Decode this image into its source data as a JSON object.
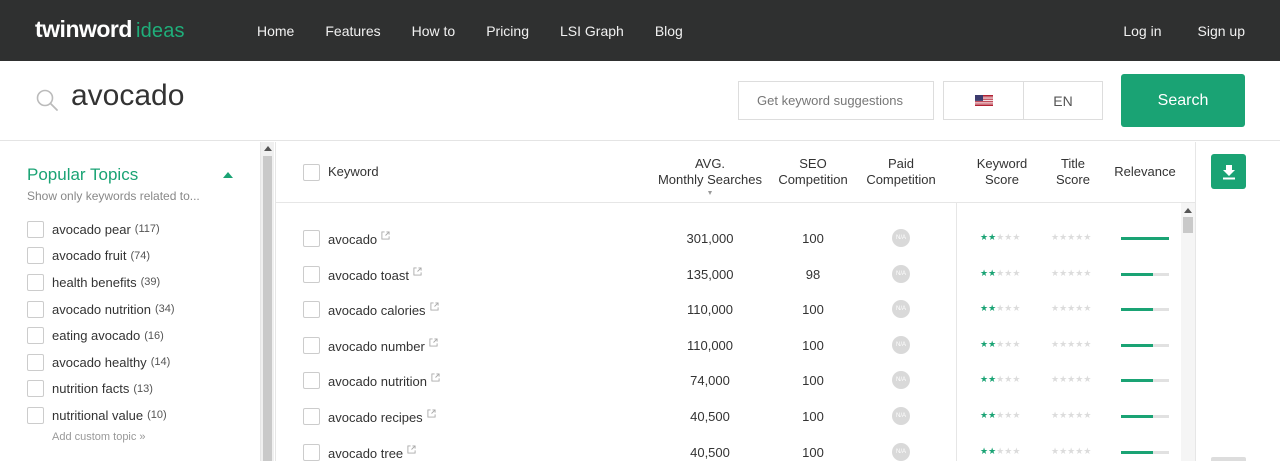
{
  "brand": {
    "name": "twinword",
    "sub": "ideas",
    "accent": "#1aa374"
  },
  "nav": {
    "items": [
      "Home",
      "Features",
      "How to",
      "Pricing",
      "LSI Graph",
      "Blog"
    ],
    "login": "Log in",
    "signup": "Sign up"
  },
  "search": {
    "query": "avocado",
    "suggest_placeholder": "Get keyword suggestions",
    "country_icon": "us-flag-icon",
    "language": "EN",
    "button": "Search"
  },
  "sidebar": {
    "title": "Popular Topics",
    "subtitle": "Show only keywords related to...",
    "topics": [
      {
        "label": "avocado pear",
        "count": "(117)"
      },
      {
        "label": "avocado fruit",
        "count": "(74)"
      },
      {
        "label": "health benefits",
        "count": "(39)"
      },
      {
        "label": "avocado nutrition",
        "count": "(34)"
      },
      {
        "label": "eating avocado",
        "count": "(16)"
      },
      {
        "label": "avocado healthy",
        "count": "(14)"
      },
      {
        "label": "nutrition facts",
        "count": "(13)"
      },
      {
        "label": "nutritional value",
        "count": "(10)"
      }
    ],
    "add_custom": "Add custom topic »"
  },
  "table": {
    "headers": {
      "keyword": "Keyword",
      "avg_1": "AVG.",
      "avg_2": "Monthly Searches",
      "seo_1": "SEO",
      "seo_2": "Competition",
      "paid_1": "Paid",
      "paid_2": "Competition",
      "ks_1": "Keyword",
      "ks_2": "Score",
      "ts_1": "Title",
      "ts_2": "Score",
      "relevance": "Relevance"
    },
    "rows": [
      {
        "keyword": "avocado",
        "volume": "301,000",
        "seo": "100",
        "paid": "N/A",
        "keyword_score": 2,
        "title_score": 0,
        "relevance": 1.0
      },
      {
        "keyword": "avocado toast",
        "volume": "135,000",
        "seo": "98",
        "paid": "N/A",
        "keyword_score": 2,
        "title_score": 0,
        "relevance": 0.66
      },
      {
        "keyword": "avocado calories",
        "volume": "110,000",
        "seo": "100",
        "paid": "N/A",
        "keyword_score": 2,
        "title_score": 0,
        "relevance": 0.66
      },
      {
        "keyword": "avocado number",
        "volume": "110,000",
        "seo": "100",
        "paid": "N/A",
        "keyword_score": 2,
        "title_score": 0,
        "relevance": 0.66
      },
      {
        "keyword": "avocado nutrition",
        "volume": "74,000",
        "seo": "100",
        "paid": "N/A",
        "keyword_score": 2,
        "title_score": 0,
        "relevance": 0.66
      },
      {
        "keyword": "avocado recipes",
        "volume": "40,500",
        "seo": "100",
        "paid": "N/A",
        "keyword_score": 2,
        "title_score": 0,
        "relevance": 0.66
      },
      {
        "keyword": "avocado tree",
        "volume": "40,500",
        "seo": "100",
        "paid": "N/A",
        "keyword_score": 2,
        "title_score": 0,
        "relevance": 0.66
      }
    ]
  },
  "export": {
    "icon": "download-icon"
  }
}
